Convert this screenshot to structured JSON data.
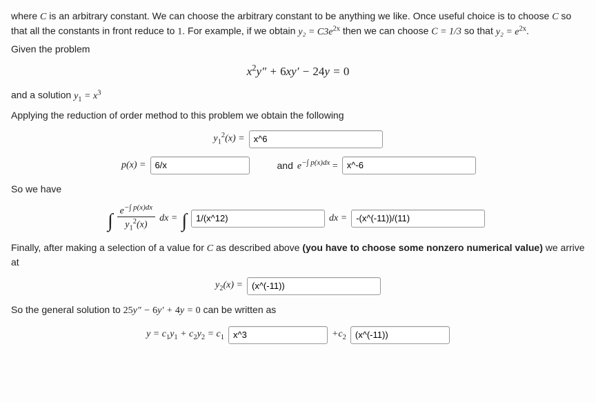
{
  "intro": {
    "line1_a": "where ",
    "line1_b": " is an arbitrary constant. We can choose the arbitrary constant to be anything we like. Once useful choice is to choose ",
    "line1_c": " so that all the constants in front reduce to ",
    "one": "1",
    "line1_d": ". For example, if we obtain ",
    "ex_lhs": "y₂ = C3e",
    "ex_exp": "2x",
    "line1_e": " then we can choose ",
    "c_eq": "C = 1/3",
    "line1_f": " so that ",
    "ex2_lhs": "y₂ = e",
    "ex2_exp": "2x",
    "period": "."
  },
  "given_label": "Given the problem",
  "ode": "x²y″ + 6xy′ − 24y = 0",
  "and_solution_a": "and a solution ",
  "and_solution_b": "y₁ = x³",
  "applying": "Applying the reduction of order method to this problem we obtain the following",
  "row1": {
    "lhs": "y₁²(x) =",
    "value": "x^6"
  },
  "row2": {
    "p_lhs": "p(x) =",
    "p_value": "6/x",
    "and": "and ",
    "e_lhs_a": "e",
    "e_exp": "−∫ p(x)dx",
    "eq": " =",
    "e_value": "x^-6"
  },
  "so_we_have": "So we have",
  "row3": {
    "frac_num_a": "e",
    "frac_num_exp": "−∫ p(x)dx",
    "frac_den": "y₁²(x)",
    "dx_eq": "dx =",
    "inner_value": "1/(x^12)",
    "dx_eq2": "dx =",
    "outer_value": "-(x^(-11))/(11)"
  },
  "finally_a": "Finally, after making a selection of a value for ",
  "finally_b": " as described above ",
  "finally_bold": "(you have to choose some nonzero numerical value)",
  "finally_c": " we arrive at",
  "row4": {
    "lhs": "y₂(x) =",
    "value": "(x^(-11))"
  },
  "gensol_a": "So the general solution to ",
  "gensol_eq": "25y″ − 6y′ + 4y = 0",
  "gensol_b": " can be written as",
  "row5": {
    "lhs": "y = c₁y₁ + c₂y₂ = c₁",
    "v1": "x^3",
    "plus": "+c₂",
    "v2": "(x^(-11))"
  }
}
